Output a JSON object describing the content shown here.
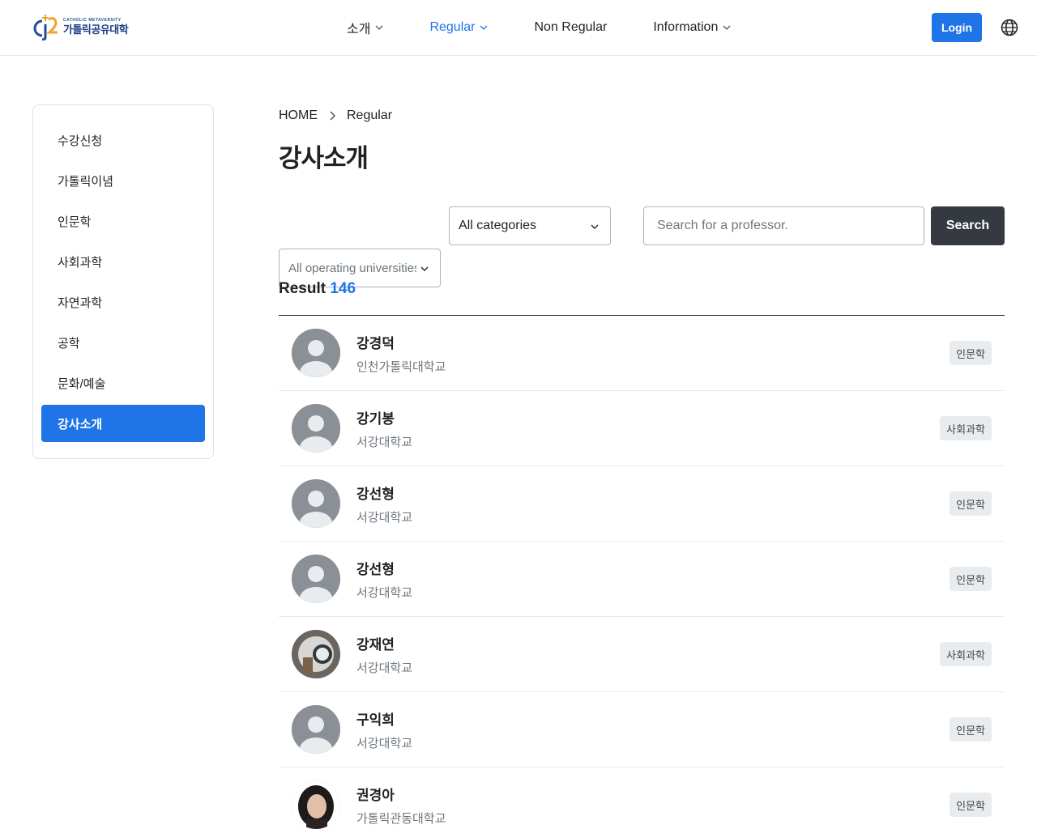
{
  "header": {
    "logo_sub": "CATHOLIC METAVERSITY",
    "logo_main": "가톨릭공유대학",
    "nav": [
      {
        "label": "소개",
        "has_dropdown": true,
        "active": false
      },
      {
        "label": "Regular",
        "has_dropdown": true,
        "active": true
      },
      {
        "label": "Non Regular",
        "has_dropdown": false,
        "active": false
      },
      {
        "label": "Information",
        "has_dropdown": true,
        "active": false
      }
    ],
    "login_label": "Login",
    "language_icon": "globe-icon"
  },
  "sidebar": {
    "items": [
      {
        "label": "수강신청",
        "active": false
      },
      {
        "label": "가톨릭이념",
        "active": false
      },
      {
        "label": "인문학",
        "active": false
      },
      {
        "label": "사회과학",
        "active": false
      },
      {
        "label": "자연과학",
        "active": false
      },
      {
        "label": "공학",
        "active": false
      },
      {
        "label": "문화/예술",
        "active": false
      },
      {
        "label": "강사소개",
        "active": true
      }
    ]
  },
  "breadcrumb": {
    "home": "HOME",
    "current": "Regular"
  },
  "page_title": "강사소개",
  "filters": {
    "university_select": "All operating universities",
    "category_select": "All categories",
    "search_placeholder": "Search for a professor.",
    "search_value": "",
    "search_button": "Search"
  },
  "result": {
    "label": "Result",
    "count": "146"
  },
  "professors": [
    {
      "name": "강경덕",
      "university": "인천가톨릭대학교",
      "category": "인문학",
      "avatar": "default"
    },
    {
      "name": "강기봉",
      "university": "서강대학교",
      "category": "사회과학",
      "avatar": "default"
    },
    {
      "name": "강선형",
      "university": "서강대학교",
      "category": "인문학",
      "avatar": "default"
    },
    {
      "name": "강선형",
      "university": "서강대학교",
      "category": "인문학",
      "avatar": "default"
    },
    {
      "name": "강재연",
      "university": "서강대학교",
      "category": "사회과학",
      "avatar": "photo"
    },
    {
      "name": "구익희",
      "university": "서강대학교",
      "category": "인문학",
      "avatar": "default"
    },
    {
      "name": "권경아",
      "university": "가톨릭관동대학교",
      "category": "인문학",
      "avatar": "photo"
    }
  ],
  "colors": {
    "accent": "#1f74e8",
    "dark_button": "#343a40",
    "badge_bg": "#e9ecef"
  }
}
